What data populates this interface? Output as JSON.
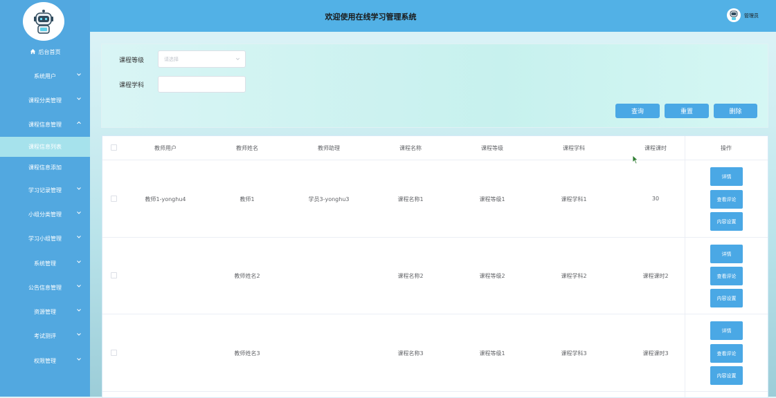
{
  "header": {
    "title": "欢迎使用在线学习管理系统",
    "user": "管理员"
  },
  "sidebar": {
    "items": [
      {
        "label": "后台首页"
      },
      {
        "label": "系统用户"
      },
      {
        "label": "课程分类管理"
      },
      {
        "label": "课程信息管理"
      },
      {
        "label": "课程信息列表"
      },
      {
        "label": "课程信息添加"
      },
      {
        "label": "学习记录管理"
      },
      {
        "label": "小组分类管理"
      },
      {
        "label": "学习小组管理"
      },
      {
        "label": "系统管理"
      },
      {
        "label": "公告信息管理"
      },
      {
        "label": "资源管理"
      },
      {
        "label": "考试测评"
      },
      {
        "label": "权限管理"
      }
    ]
  },
  "search": {
    "level_label": "课程等级",
    "level_placeholder": "请选择",
    "subject_label": "课程学科",
    "subject_value": "",
    "query_btn": "查询",
    "reset_btn": "重置",
    "delete_btn": "删除"
  },
  "table": {
    "columns": [
      "教师用户",
      "教师姓名",
      "教师助理",
      "课程名称",
      "课程等级",
      "课程学科",
      "课程课时",
      "操作"
    ],
    "rows": [
      {
        "teacher_user": "教师1-yonghu4",
        "teacher_name": "教师1",
        "assistant": "学员3-yonghu3",
        "course_name": "课程名称1",
        "level": "课程等级1",
        "subject": "课程学科1",
        "hours": "30"
      },
      {
        "teacher_user": "",
        "teacher_name": "教师姓名2",
        "assistant": "",
        "course_name": "课程名称2",
        "level": "课程等级2",
        "subject": "课程学科2",
        "hours": "课程课时2"
      },
      {
        "teacher_user": "",
        "teacher_name": "教师姓名3",
        "assistant": "",
        "course_name": "课程名称3",
        "level": "课程等级1",
        "subject": "课程学科3",
        "hours": "课程课时3"
      }
    ],
    "actions": {
      "detail": "详情",
      "review": "查看评论",
      "content": "内容设置"
    }
  },
  "colors": {
    "sidebar": "#52a8e0",
    "header": "#52b1e6",
    "button": "#4aa8e5",
    "active_item": "#a6e2ec"
  }
}
